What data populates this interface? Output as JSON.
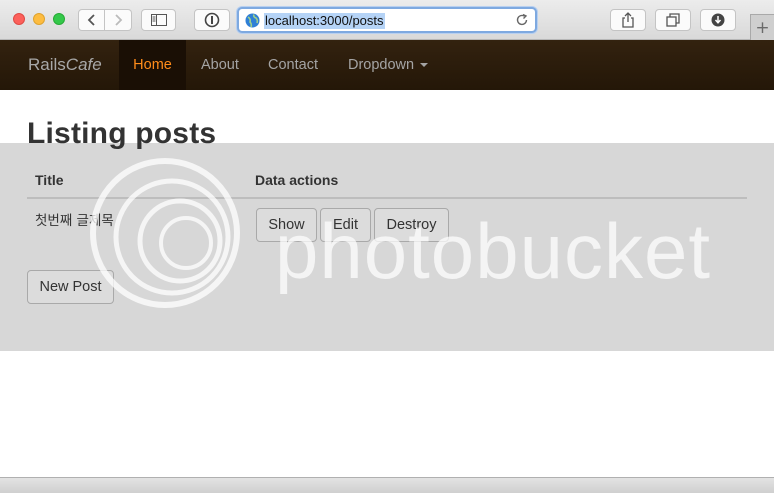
{
  "browser": {
    "url": "localhost:3000/posts",
    "new_tab_label": "+"
  },
  "navbar": {
    "brand_plain": "Rails",
    "brand_italic": "Cafe",
    "items": [
      {
        "label": "Home",
        "active": true
      },
      {
        "label": "About"
      },
      {
        "label": "Contact"
      },
      {
        "label": "Dropdown"
      }
    ],
    "accent_color": "#ff8c1a"
  },
  "page": {
    "title": "Listing posts",
    "columns": [
      "Title",
      "Data actions"
    ],
    "rows": [
      {
        "title": "첫번째 글제목",
        "actions": [
          "Show",
          "Edit",
          "Destroy"
        ]
      }
    ],
    "new_post_label": "New Post"
  },
  "watermark": {
    "text": "photobucket"
  }
}
